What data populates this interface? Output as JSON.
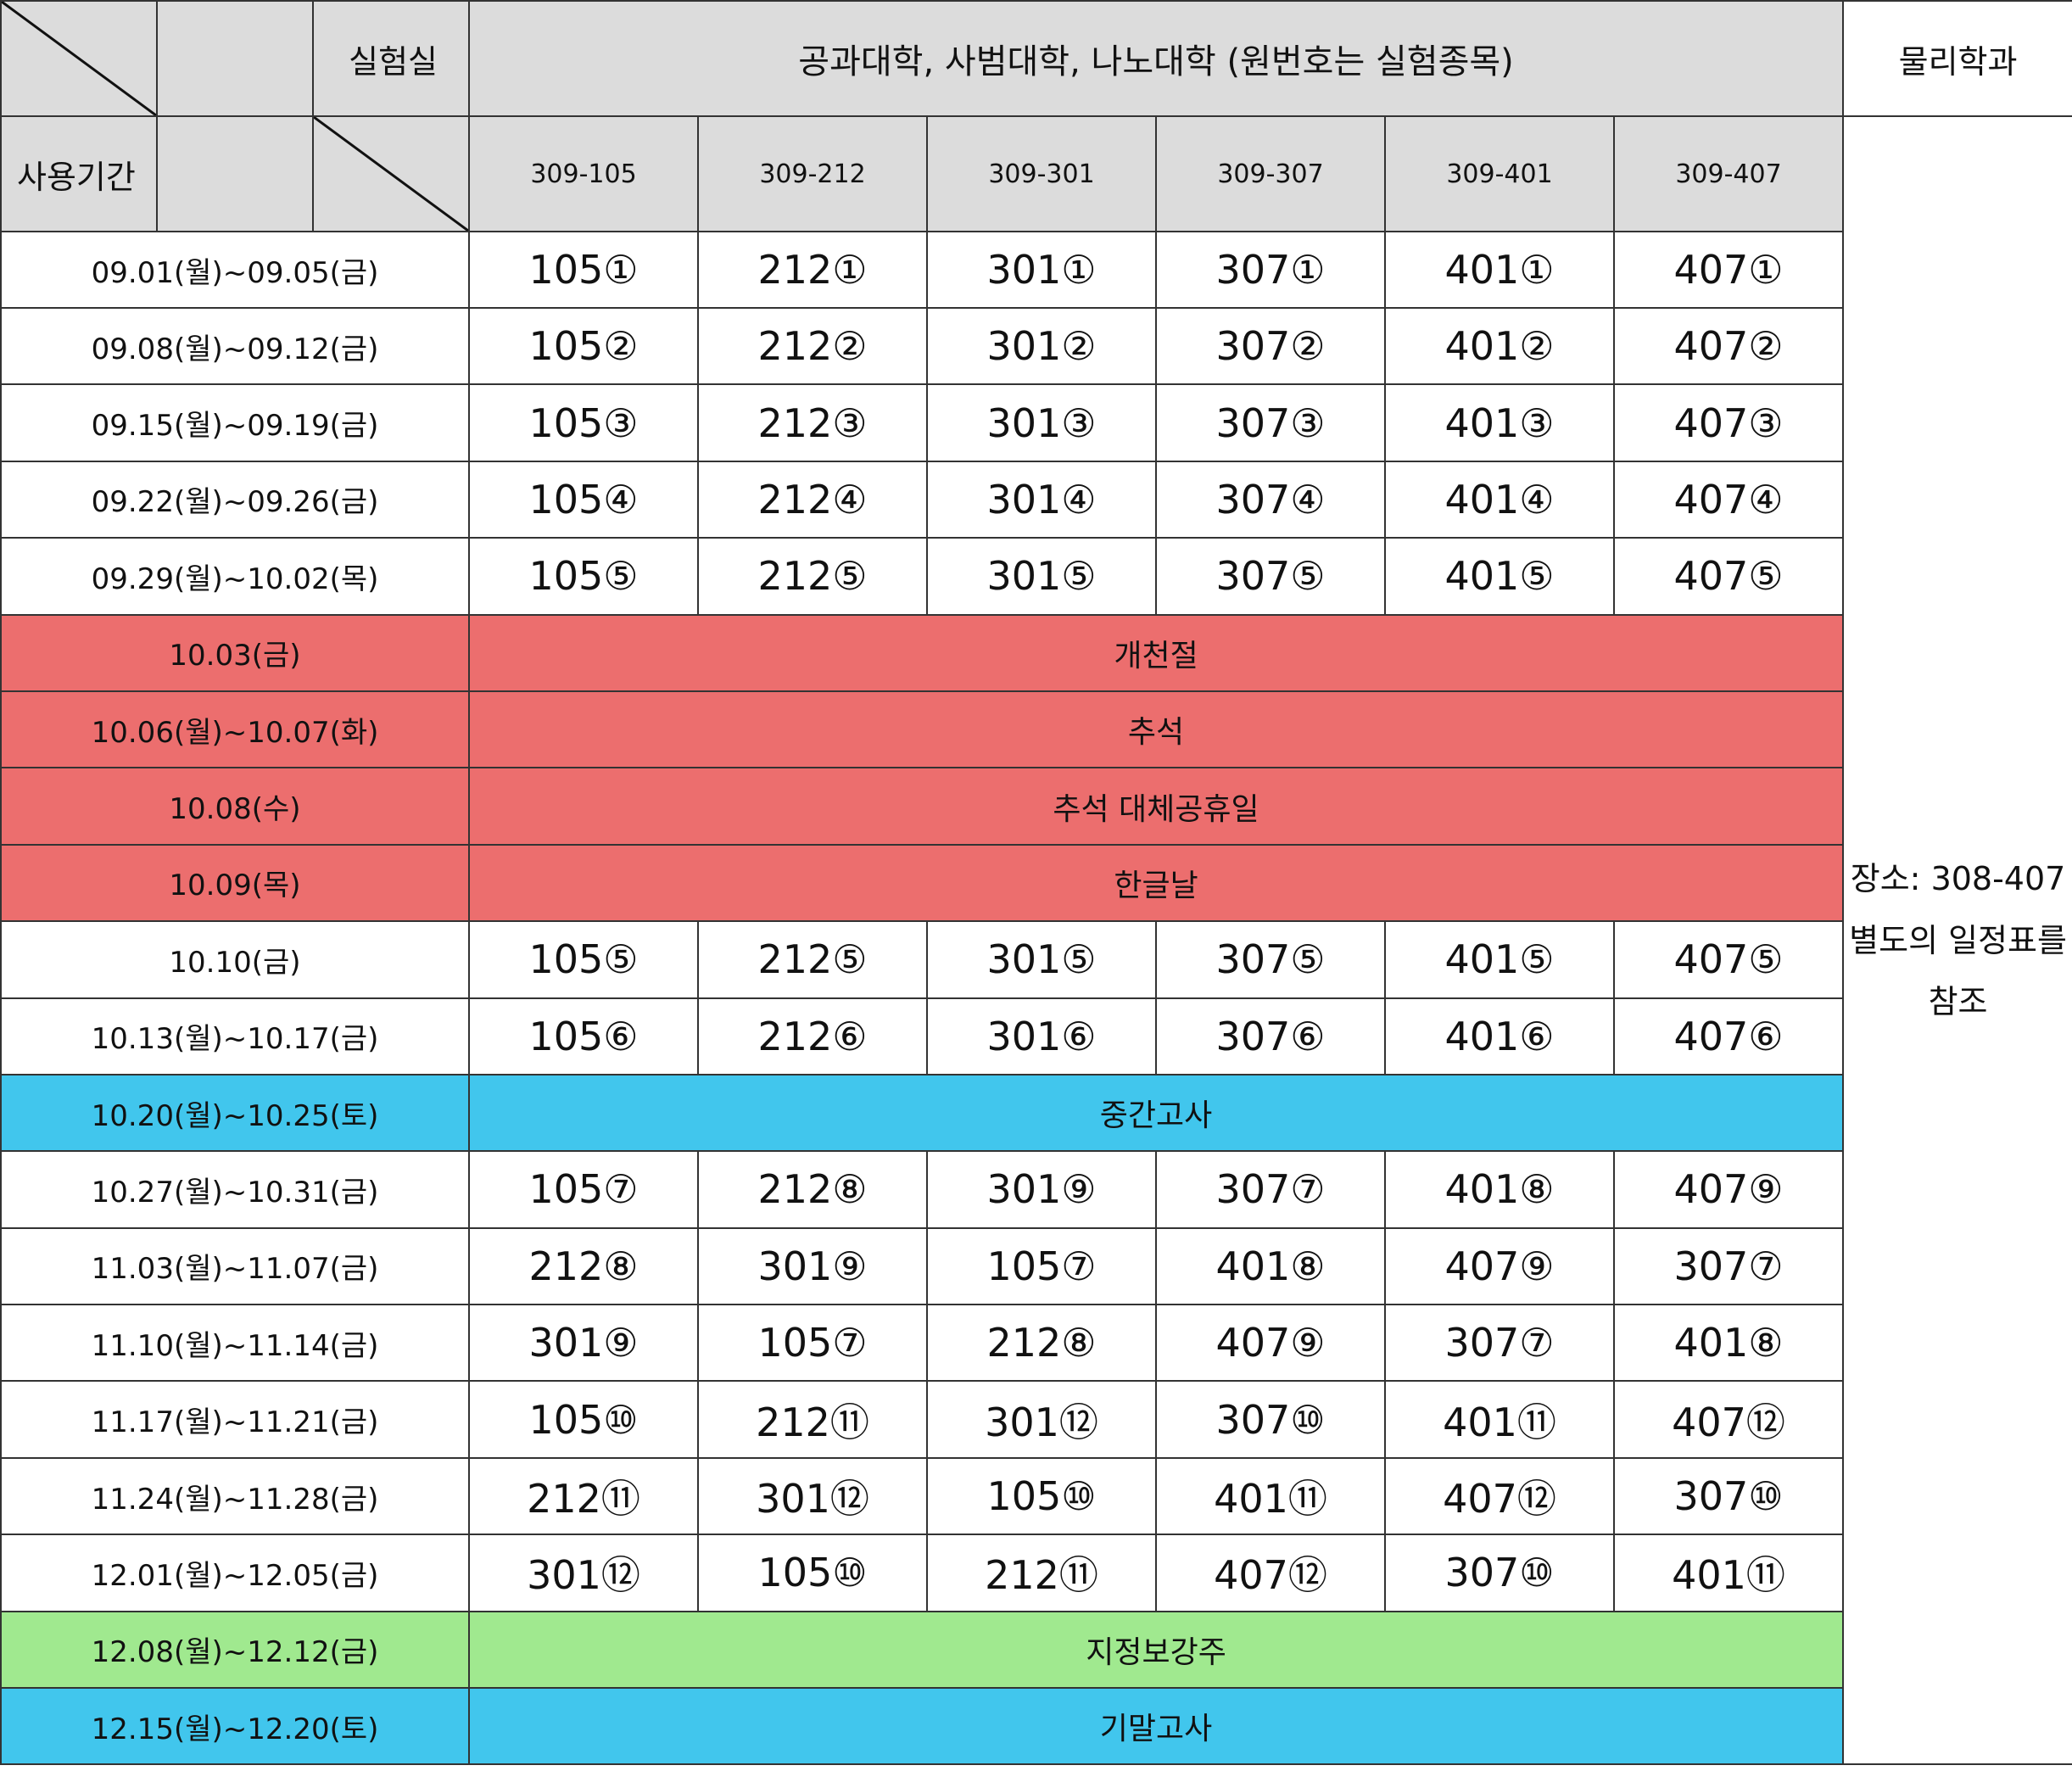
{
  "header": {
    "lab_label": "실험실",
    "period_label": "사용기간",
    "group_title": "공과대학, 사범대학, 나노대학 (원번호는 실험종목)",
    "physics_title": "물리학과",
    "rooms": [
      "309-105",
      "309-212",
      "309-301",
      "309-307",
      "309-401",
      "309-407"
    ]
  },
  "physics_note": "장소: 308-407 별도의 일정표를 참조",
  "colors": {
    "header_bg": "#dcdcdc",
    "holiday": "#ec6e6e",
    "exam": "#41c6ed",
    "makeup": "#a0e98f"
  },
  "rows": [
    {
      "date": "09.01(월)~09.05(금)",
      "values": [
        "105①",
        "212①",
        "301①",
        "307①",
        "401①",
        "407①"
      ]
    },
    {
      "date": "09.08(월)~09.12(금)",
      "values": [
        "105②",
        "212②",
        "301②",
        "307②",
        "401②",
        "407②"
      ]
    },
    {
      "date": "09.15(월)~09.19(금)",
      "values": [
        "105③",
        "212③",
        "301③",
        "307③",
        "401③",
        "407③"
      ]
    },
    {
      "date": "09.22(월)~09.26(금)",
      "values": [
        "105④",
        "212④",
        "301④",
        "307④",
        "401④",
        "407④"
      ]
    },
    {
      "date": "09.29(월)~10.02(목)",
      "values": [
        "105⑤",
        "212⑤",
        "301⑤",
        "307⑤",
        "401⑤",
        "407⑤"
      ]
    },
    {
      "date": "10.03(금)",
      "event": "개천절",
      "kind": "holiday"
    },
    {
      "date": "10.06(월)~10.07(화)",
      "event": "추석",
      "kind": "holiday"
    },
    {
      "date": "10.08(수)",
      "event": "추석 대체공휴일",
      "kind": "holiday"
    },
    {
      "date": "10.09(목)",
      "event": "한글날",
      "kind": "holiday"
    },
    {
      "date": "10.10(금)",
      "values": [
        "105⑤",
        "212⑤",
        "301⑤",
        "307⑤",
        "401⑤",
        "407⑤"
      ]
    },
    {
      "date": "10.13(월)~10.17(금)",
      "values": [
        "105⑥",
        "212⑥",
        "301⑥",
        "307⑥",
        "401⑥",
        "407⑥"
      ]
    },
    {
      "date": "10.20(월)~10.25(토)",
      "event": "중간고사",
      "kind": "exam"
    },
    {
      "date": "10.27(월)~10.31(금)",
      "values": [
        "105⑦",
        "212⑧",
        "301⑨",
        "307⑦",
        "401⑧",
        "407⑨"
      ]
    },
    {
      "date": "11.03(월)~11.07(금)",
      "values": [
        "212⑧",
        "301⑨",
        "105⑦",
        "401⑧",
        "407⑨",
        "307⑦"
      ]
    },
    {
      "date": "11.10(월)~11.14(금)",
      "values": [
        "301⑨",
        "105⑦",
        "212⑧",
        "407⑨",
        "307⑦",
        "401⑧"
      ]
    },
    {
      "date": "11.17(월)~11.21(금)",
      "values": [
        "105⑩",
        "212⑪",
        "301⑫",
        "307⑩",
        "401⑪",
        "407⑫"
      ]
    },
    {
      "date": "11.24(월)~11.28(금)",
      "values": [
        "212⑪",
        "301⑫",
        "105⑩",
        "401⑪",
        "407⑫",
        "307⑩"
      ]
    },
    {
      "date": "12.01(월)~12.05(금)",
      "values": [
        "301⑫",
        "105⑩",
        "212⑪",
        "407⑫",
        "307⑩",
        "401⑪"
      ]
    },
    {
      "date": "12.08(월)~12.12(금)",
      "event": "지정보강주",
      "kind": "makeup"
    },
    {
      "date": "12.15(월)~12.20(토)",
      "event": "기말고사",
      "kind": "exam"
    }
  ]
}
